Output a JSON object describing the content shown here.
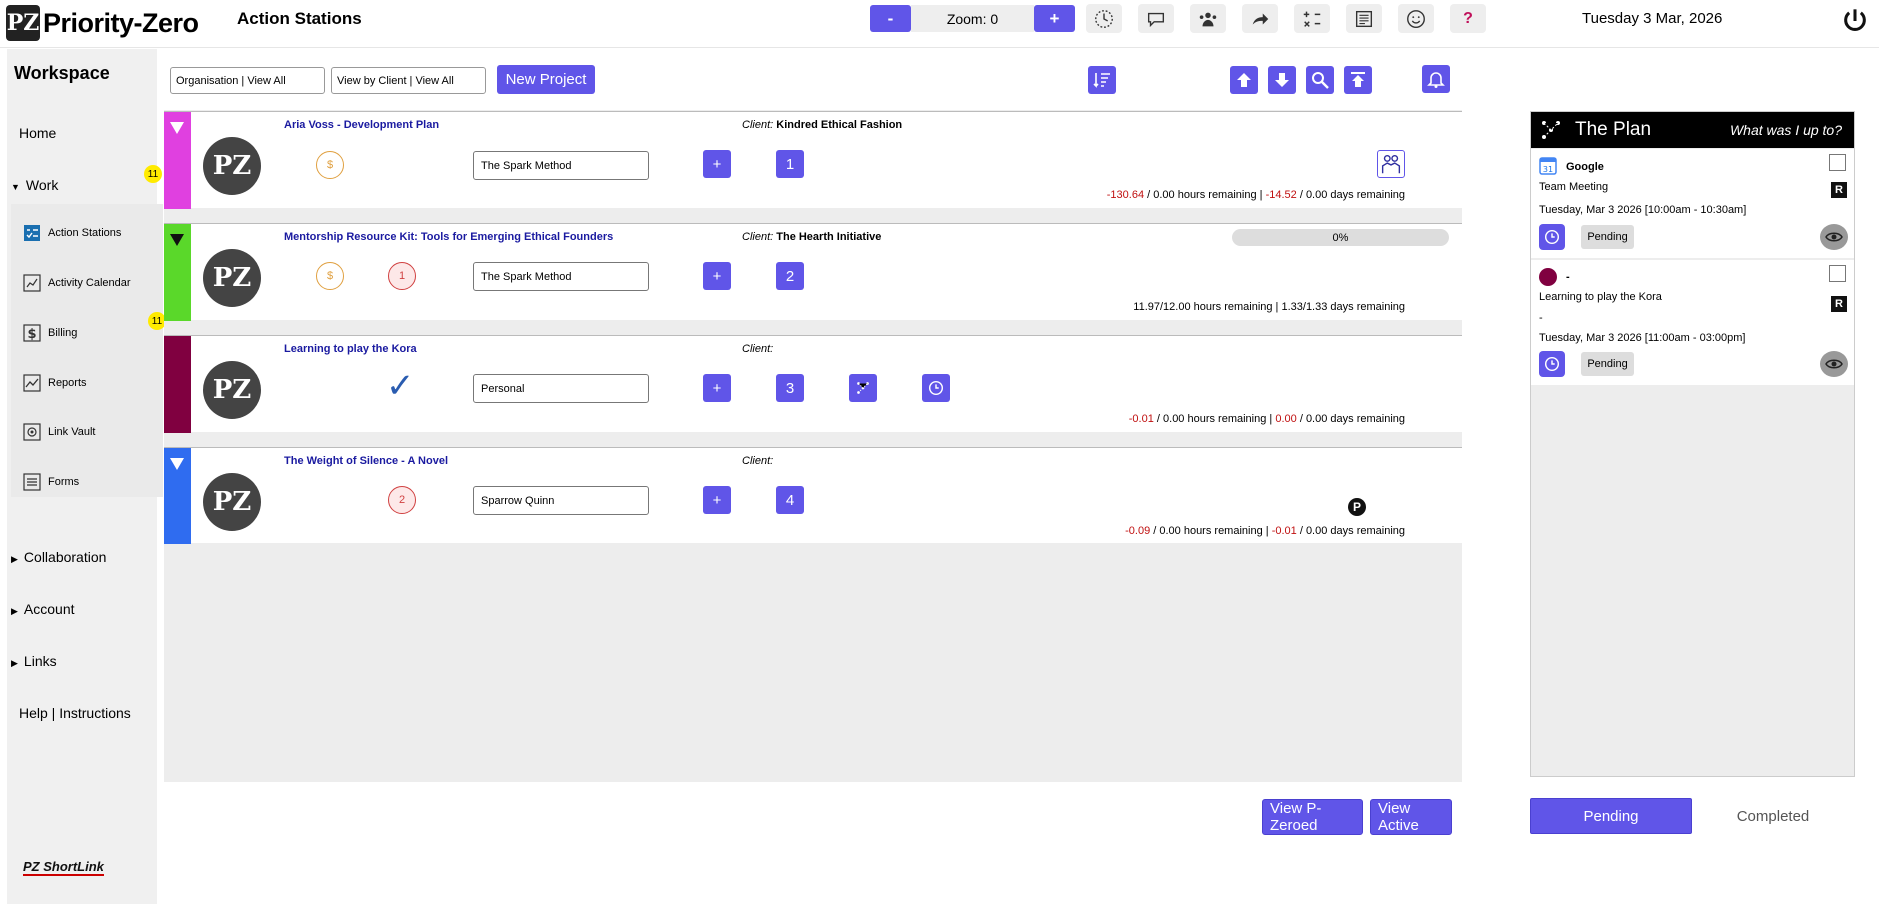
{
  "app": {
    "name": "Priority-Zero",
    "page_title": "Action Stations",
    "date": "Tuesday 3 Mar, 2026"
  },
  "zoom": {
    "minus": "-",
    "label": "Zoom: 0",
    "plus": "+"
  },
  "toolbar_icons": [
    "clock-dial-icon",
    "speech-bubble-icon",
    "team-icon",
    "share-arrow-icon",
    "calculator-icon",
    "news-icon",
    "smiley-icon",
    "help-icon"
  ],
  "help_label": "?",
  "sidebar": {
    "title": "Workspace",
    "home": "Home",
    "work": "Work",
    "work_badge": "11",
    "sub_items": [
      {
        "label": "Action Stations",
        "icon": "checklist-icon"
      },
      {
        "label": "Activity Calendar",
        "icon": "calendar-icon",
        "badge": "11"
      },
      {
        "label": "Billing",
        "icon": "dollar-icon"
      },
      {
        "label": "Reports",
        "icon": "chart-icon"
      },
      {
        "label": "Link Vault",
        "icon": "vault-icon"
      },
      {
        "label": "Forms",
        "icon": "form-icon"
      }
    ],
    "collaboration": "Collaboration",
    "account": "Account",
    "links": "Links",
    "help": "Help | Instructions",
    "shortlink": "PZ ShortLink"
  },
  "filters": {
    "organisation": "Organisation | View All",
    "client": "View by Client | View All",
    "new_project": "New Project"
  },
  "projects": [
    {
      "name": "Aria Voss - Development Plan",
      "client_label": "Client:",
      "client": "Kindred Ethical Fashion",
      "method": "The Spark Method",
      "add": "+",
      "num": "1",
      "color": "#e040e0",
      "coin": "$",
      "rem_hours_val": "-130.64",
      "rem_hours_rest": "/ 0.00 hours remaining",
      "sep": "|",
      "rem_days_val": "-14.52",
      "rem_days_rest": "/ 0.00 days remaining"
    },
    {
      "name": "Mentorship Resource Kit: Tools for Emerging Ethical Founders",
      "client_label": "Client:",
      "client": "The Hearth Initiative",
      "method": "The Spark Method",
      "add": "+",
      "num": "2",
      "color": "#5ad82a",
      "coin": "$",
      "priority": "1",
      "progress": "0%",
      "remaining": "11.97/12.00 hours remaining  |  1.33/1.33 days remaining"
    },
    {
      "name": "Learning to play the Kora",
      "client_label": "Client:",
      "client": "",
      "method": "Personal",
      "add": "+",
      "num": "3",
      "color": "#800040",
      "check": "✓",
      "rem_hours_val": "-0.01",
      "rem_hours_rest": "/ 0.00 hours remaining",
      "sep": "|",
      "rem_days_val": "0.00",
      "rem_days_rest": "/ 0.00 days remaining"
    },
    {
      "name": "The Weight of Silence - A Novel",
      "client_label": "Client:",
      "client": "",
      "method": "Sparrow Quinn",
      "add": "+",
      "num": "4",
      "color": "#2f6cf0",
      "priority": "2",
      "p_badge": "P",
      "rem_hours_val": "-0.09",
      "rem_hours_rest": "/ 0.00 hours remaining",
      "sep": "|",
      "rem_days_val": "-0.01",
      "rem_days_rest": "/ 0.00 days remaining"
    }
  ],
  "footer": {
    "view_pzeroed": "View P-Zeroed",
    "view_active": "View Active"
  },
  "plan": {
    "title": "The Plan",
    "subtitle": "What was I up to?",
    "cards": [
      {
        "source": "Google",
        "title": "Team Meeting",
        "r": "R",
        "when": "Tuesday, Mar 3 2026 [10:00am - 10:30am]",
        "status": "Pending"
      },
      {
        "source": "-",
        "dot_color": "#800040",
        "title": "Learning to play the Kora",
        "dash": "-",
        "r": "R",
        "when": "Tuesday, Mar 3 2026 [11:00am - 03:00pm]",
        "status": "Pending"
      }
    ],
    "tab_pending": "Pending",
    "tab_completed": "Completed"
  }
}
